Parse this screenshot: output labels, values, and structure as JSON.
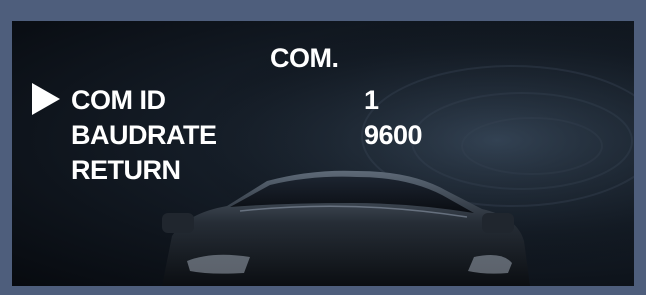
{
  "menu": {
    "title": "COM.",
    "items": [
      {
        "label": "COM ID",
        "value": "1",
        "selected": true
      },
      {
        "label": "BAUDRATE",
        "value": "9600",
        "selected": false
      },
      {
        "label": "RETURN",
        "value": "",
        "selected": false
      }
    ]
  },
  "icons": {
    "cursor": "triangle-right-icon"
  },
  "colors": {
    "frame": "#4e5e7c",
    "text": "#ffffff",
    "background": "#0d131b"
  }
}
